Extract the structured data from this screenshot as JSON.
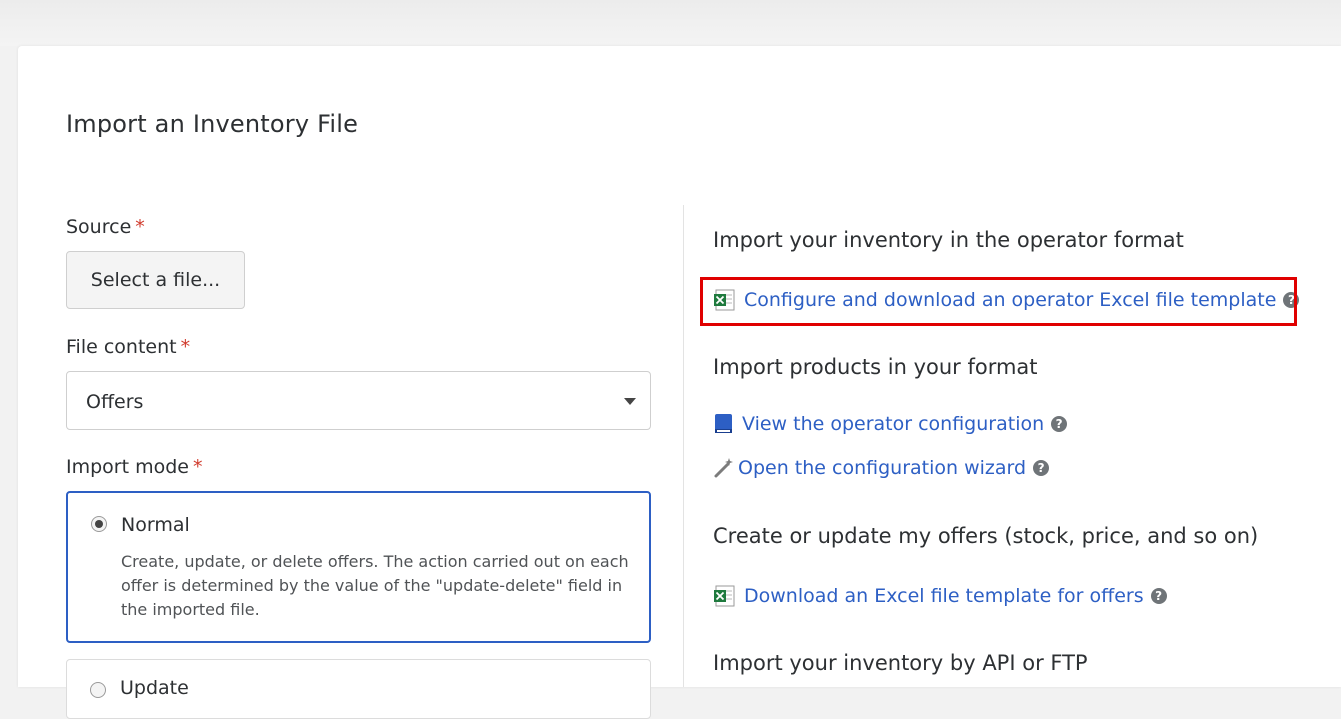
{
  "page": {
    "title": "Import an Inventory File"
  },
  "form": {
    "source": {
      "label": "Source",
      "required_mark": "*",
      "button_label": "Select a file..."
    },
    "file_content": {
      "label": "File content",
      "required_mark": "*",
      "selected": "Offers"
    },
    "import_mode": {
      "label": "Import mode",
      "required_mark": "*",
      "options": [
        {
          "title": "Normal",
          "description": "Create, update, or delete offers. The action carried out on each offer is determined by the value of the \"update-delete\" field in the imported file.",
          "selected": true
        },
        {
          "title": "Update",
          "selected": false
        }
      ]
    }
  },
  "right": {
    "sections": [
      {
        "title": "Import your inventory in the operator format"
      },
      {
        "title": "Import products in your format"
      },
      {
        "title": "Create or update my offers (stock, price, and so on)"
      },
      {
        "title": "Import your inventory by API or FTP"
      }
    ],
    "links": {
      "configure_template": {
        "label": "Configure and download an operator Excel file template",
        "icon": "excel-icon"
      },
      "view_config": {
        "label": "View the operator configuration",
        "icon": "book-icon"
      },
      "config_wizard": {
        "label": "Open the configuration wizard",
        "icon": "magic-wand-icon"
      },
      "download_offers_template": {
        "label": "Download an Excel file template for offers",
        "icon": "excel-icon"
      }
    },
    "help_glyph": "?"
  },
  "colors": {
    "accent": "#2d5fc4",
    "required": "#d03a2c",
    "highlight": "#e00000"
  }
}
